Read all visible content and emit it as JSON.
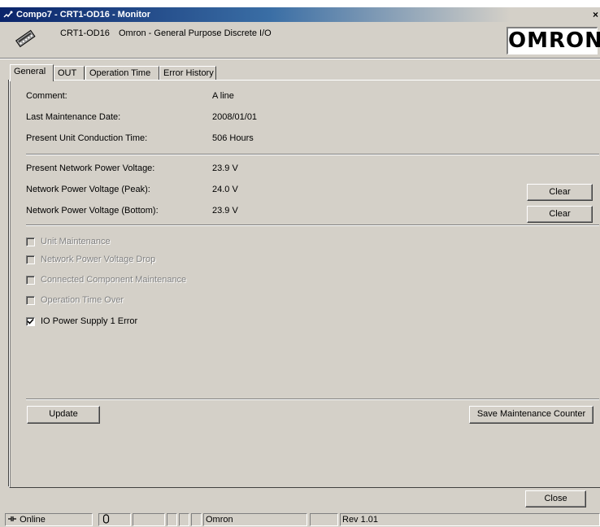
{
  "window": {
    "title": "Compo7 - CRT1-OD16 - Monitor",
    "close_glyph": "×"
  },
  "header": {
    "model": "CRT1-OD16",
    "description": "Omron - General Purpose Discrete I/O",
    "logo_text": "OMRON",
    "device_icon": "device-module-icon"
  },
  "tabs": [
    {
      "label": "General",
      "active": true
    },
    {
      "label": "OUT",
      "active": false
    },
    {
      "label": "Operation Time",
      "active": false
    },
    {
      "label": "Error History",
      "active": false
    }
  ],
  "general": {
    "comment_label": "Comment:",
    "comment_value": "A line",
    "last_maintenance_label": "Last Maintenance Date:",
    "last_maintenance_value": "2008/01/01",
    "conduction_label": "Present Unit Conduction Time:",
    "conduction_value": "506 Hours",
    "present_voltage_label": "Present Network Power Voltage:",
    "present_voltage_value": "23.9 V",
    "peak_voltage_label": "Network Power Voltage (Peak):",
    "peak_voltage_value": "24.0 V",
    "bottom_voltage_label": "Network Power Voltage (Bottom):",
    "bottom_voltage_value": "23.9 V",
    "clear_label": "Clear",
    "clear2_label": "Clear"
  },
  "status_flags": [
    {
      "label": "Unit Maintenance",
      "checked": false,
      "enabled": false
    },
    {
      "label": "Network Power Voltage Drop",
      "checked": false,
      "enabled": false
    },
    {
      "label": "Connected Component Maintenance",
      "checked": false,
      "enabled": false
    },
    {
      "label": "Operation Time Over",
      "checked": false,
      "enabled": false
    },
    {
      "label": "IO Power Supply 1 Error",
      "checked": true,
      "enabled": true
    }
  ],
  "actions": {
    "update_label": "Update",
    "save_counter_label": "Save Maintenance Counter",
    "close_label": "Close"
  },
  "statusbar": {
    "online_label": "Online",
    "vendor": "Omron",
    "revision": "Rev 1.01"
  },
  "colors": {
    "face": "#d4d0c8",
    "title_start": "#0a246a",
    "disabled_text": "#808080"
  }
}
